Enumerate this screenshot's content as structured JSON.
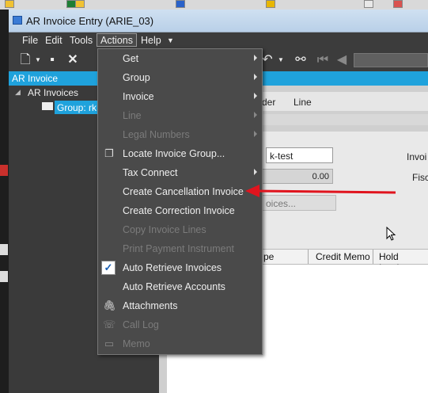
{
  "window": {
    "title": "AR Invoice Entry (ARIE_03)"
  },
  "menubar": [
    "File",
    "Edit",
    "Tools",
    "Actions",
    "Help"
  ],
  "tree": {
    "header": "AR Invoice",
    "root": "AR Invoices",
    "selected": "Group: rk"
  },
  "form": {
    "tabs": [
      "der",
      "Line"
    ],
    "group_value": "k-test",
    "amount_value": "0.00",
    "invoice_label": "Invoi",
    "fiscal_label": "Fisc",
    "invoices_btn": "oices...",
    "grid_columns": [
      "pe",
      "Credit Memo",
      "Hold Invoice"
    ]
  },
  "dropdown": {
    "items": [
      {
        "label": "Get",
        "submenu": true,
        "disabled": false,
        "icon": ""
      },
      {
        "label": "Group",
        "submenu": true,
        "disabled": false,
        "icon": ""
      },
      {
        "label": "Invoice",
        "submenu": true,
        "disabled": false,
        "icon": ""
      },
      {
        "label": "Line",
        "submenu": true,
        "disabled": true,
        "icon": ""
      },
      {
        "label": "Legal Numbers",
        "submenu": true,
        "disabled": true,
        "icon": ""
      },
      {
        "label": "Locate Invoice Group...",
        "submenu": false,
        "disabled": false,
        "icon": "window-icon"
      },
      {
        "label": "Tax Connect",
        "submenu": true,
        "disabled": false,
        "icon": ""
      },
      {
        "label": "Create Cancellation Invoice",
        "submenu": false,
        "disabled": false,
        "icon": ""
      },
      {
        "label": "Create Correction Invoice",
        "submenu": false,
        "disabled": false,
        "icon": ""
      },
      {
        "label": "Copy Invoice Lines",
        "submenu": false,
        "disabled": true,
        "icon": ""
      },
      {
        "label": "Print Payment Instrument",
        "submenu": false,
        "disabled": true,
        "icon": ""
      },
      {
        "label": "Auto Retrieve Invoices",
        "submenu": false,
        "disabled": false,
        "icon": "checkbox-checked-icon"
      },
      {
        "label": "Auto Retrieve Accounts",
        "submenu": false,
        "disabled": false,
        "icon": ""
      },
      {
        "label": "Attachments",
        "submenu": false,
        "disabled": false,
        "icon": "paperclip-icon"
      },
      {
        "label": "Call Log",
        "submenu": false,
        "disabled": true,
        "icon": "phone-icon"
      },
      {
        "label": "Memo",
        "submenu": false,
        "disabled": true,
        "icon": "memo-icon"
      }
    ]
  },
  "colors": {
    "accent": "#1fa2dc",
    "annotation_arrow": "#e0141e"
  }
}
